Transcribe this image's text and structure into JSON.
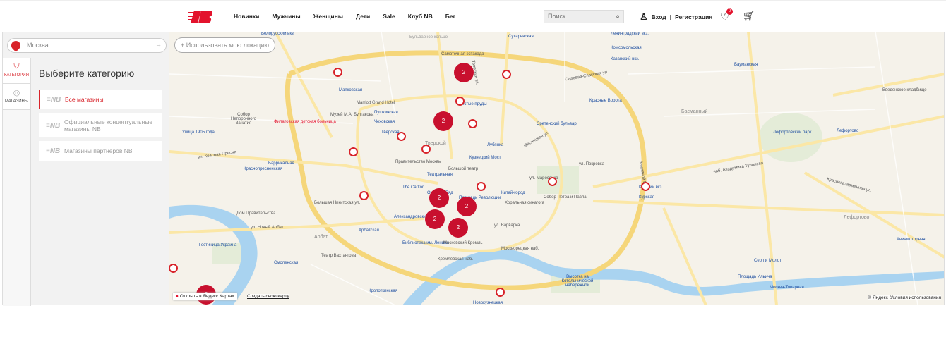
{
  "header": {
    "nav": [
      "Новинки",
      "Мужчины",
      "Женщины",
      "Дети",
      "Sale",
      "Клуб NB",
      "Бег"
    ],
    "search_placeholder": "Поиск",
    "login": "Вход",
    "register": "Регистрация",
    "wishlist_count": "0"
  },
  "panel": {
    "city_placeholder": "Москва",
    "tabs": [
      "КАТЕГОРИЯ",
      "МАГАЗИНЫ"
    ],
    "title": "Выберите категорию",
    "categories": [
      "Все магазины",
      "Официальные концептуальные магазины NB",
      "Магазины партнеров NB"
    ]
  },
  "map": {
    "use_location": "Использовать мою локацию",
    "open_yandex": "Открыть в Яндекс.Картах",
    "create_map": "Создать свою карту",
    "copyright": "© Яндекс",
    "terms": "Условия использования",
    "clusters": [
      "2",
      "2",
      "2",
      "2",
      "2",
      "2",
      "2"
    ],
    "labels": {
      "metro": [
        "Маяковская",
        "Пушкинская",
        "Чеховская",
        "Тверская",
        "Баррикадная",
        "Краснопресненская",
        "Улица 1905 года",
        "Арбатская",
        "Смоленская",
        "Библиотека им. Ленина",
        "Кропоткинская",
        "Лубянка",
        "Кузнецкий Мост",
        "Китай-город",
        "Сретенский бульвар",
        "Красные Ворота",
        "Чистые пруды",
        "Сухаревская",
        "Комсомольская",
        "Курская",
        "Бауманская",
        "Лефортово",
        "Площадь Ильича",
        "Авиамоторная",
        "Театральная",
        "Площадь Революции",
        "Охотный Ряд",
        "Александровский сад",
        "Новокузнецкая"
      ],
      "places": [
        "Тверской",
        "Басманный",
        "Арбат",
        "Лефортово",
        "Московский Кремль",
        "Большой театр",
        "Правительство Москвы",
        "The Carlton",
        "Marriott Grand Hotel",
        "Музей М.А. Булгакова",
        "Собор Непорочного Зачатия",
        "Дом Правительства",
        "Гостиница Украина",
        "Театр Вахтангова",
        "Собор Петра и Павла",
        "Хоральная синагога",
        "Высотка на Котельнической набережной",
        "Лефортовский парк",
        "Казанский вкз.",
        "Курский вкз.",
        "Ленинградский вкз.",
        "Белорусский вкз.",
        "Серп и Молот",
        "Москва-Товарная",
        "Введенское кладбище",
        "Филатовская детская больница"
      ],
      "streets": [
        "Садовая-Спасская ул.",
        "Самотечная эстакада",
        "ул. Красная Пресня",
        "Большая Никитская ул.",
        "ул. Новый Арбат",
        "Мясницкая ул.",
        "ул. Покровка",
        "ул. Маросейка",
        "Бульварное кольцо",
        "Кремлёвская наб.",
        "Москворецкая наб.",
        "наб. Академика Туполева",
        "Красноказарменная ул.",
        "ул. Варварка",
        "Тверская ул.",
        "Земляной Вал"
      ]
    }
  }
}
